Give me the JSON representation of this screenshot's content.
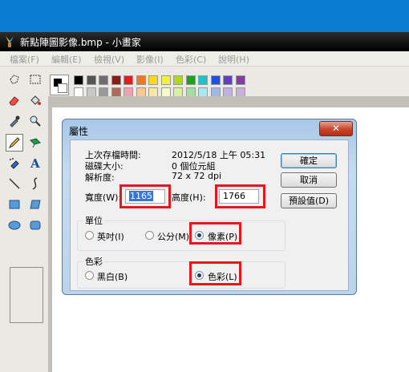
{
  "window": {
    "title": "新點陣圖影像.bmp - 小畫家"
  },
  "menu": [
    "檔案(F)",
    "編輯(E)",
    "檢視(V)",
    "影像(I)",
    "色彩(C)",
    "說明(H)"
  ],
  "tools": [
    {
      "name": "free-select-icon"
    },
    {
      "name": "rect-select-icon"
    },
    {
      "name": "eraser-icon"
    },
    {
      "name": "fill-bucket-icon"
    },
    {
      "name": "eyedropper-icon"
    },
    {
      "name": "magnifier-icon"
    },
    {
      "name": "pencil-icon"
    },
    {
      "name": "brush-icon"
    },
    {
      "name": "airbrush-icon"
    },
    {
      "name": "text-icon"
    },
    {
      "name": "line-icon"
    },
    {
      "name": "curve-icon"
    },
    {
      "name": "rectangle-icon"
    },
    {
      "name": "polygon-icon"
    },
    {
      "name": "ellipse-icon"
    },
    {
      "name": "rounded-rect-icon"
    }
  ],
  "palette": {
    "top": [
      "#000000",
      "#808080",
      "#800000",
      "#808000",
      "#008000",
      "#008080",
      "#000080",
      "#800080",
      "#808040",
      "#004040",
      "#0080ff",
      "#004080",
      "#8000ff",
      "#804000"
    ],
    "topVisible": [
      "#000000",
      "#555555",
      "#6e6e6e",
      "#8b1a1a",
      "#e02020",
      "#f07820",
      "#f8d820",
      "#f0f040",
      "#b0d820",
      "#20a020",
      "#20c0d0",
      "#2050e0",
      "#6040c0",
      "#8040a0"
    ],
    "bottomVisible": [
      "#ffffff",
      "#c8c8c8",
      "#9a9a9a",
      "#b06a5a",
      "#f0a0b0",
      "#f8c890",
      "#f8e8a8",
      "#f8f8c8",
      "#d8f0a0",
      "#a0e0a0",
      "#a8e8f0",
      "#a0b8e8",
      "#c0b0e0",
      "#c8b0d8"
    ]
  },
  "dialog": {
    "title": "屬性",
    "close": "✕",
    "info": {
      "lastSaved_label": "上次存檔時間:",
      "lastSaved_value": "2012/5/18 上午 05:31",
      "diskSize_label": "磁碟大小:",
      "diskSize_value": "0 個位元組",
      "resolution_label": "解析度:",
      "resolution_value": "72 x 72 dpi"
    },
    "width_label": "寬度(W):",
    "width_value": "1165",
    "height_label": "高度(H):",
    "height_value": "1766",
    "units": {
      "group_label": "單位",
      "inch": "英吋(I)",
      "cm": "公分(M)",
      "pixel": "像素(P)",
      "selected": "pixel"
    },
    "colors": {
      "group_label": "色彩",
      "bw": "黑白(B)",
      "color": "色彩(L)",
      "selected": "color"
    },
    "buttons": {
      "ok": "確定",
      "cancel": "取消",
      "default": "預設值(D)"
    }
  }
}
